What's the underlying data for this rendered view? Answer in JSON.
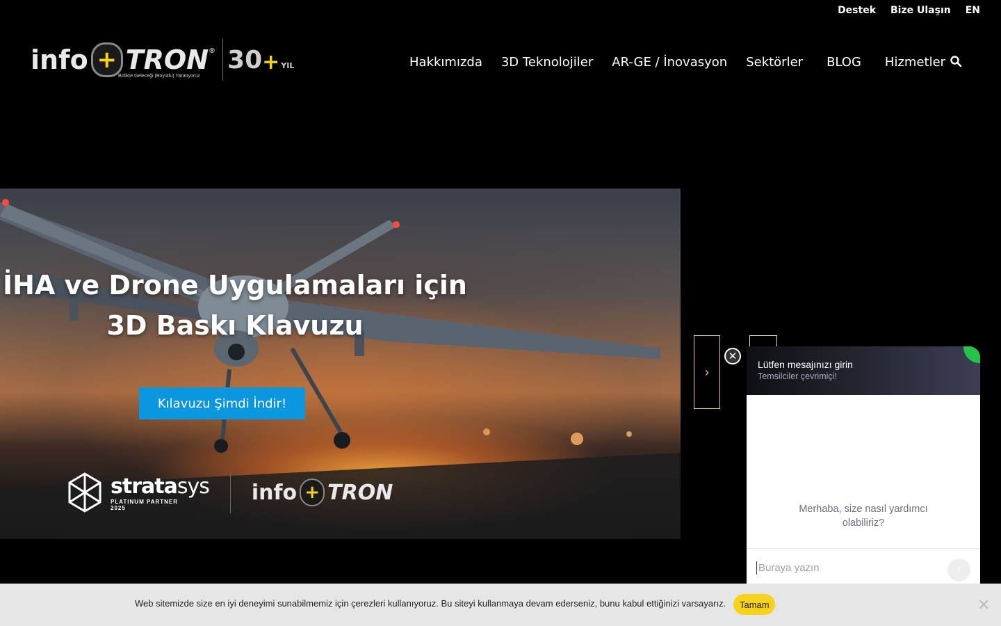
{
  "topbar": {
    "support": "Destek",
    "contact": "Bize Ulaşın",
    "lang": "EN"
  },
  "logo": {
    "info": "info",
    "plus": "+",
    "tron": "TRON",
    "reg": "®",
    "tagline": "Birlikte Geleceği (Boyutlu) Yaratıyoruz",
    "anniv_num": "30",
    "anniv_plus": "+",
    "anniv_label": "YIL"
  },
  "nav": {
    "items": [
      "Hakkımızda",
      "3D Teknolojiler",
      "AR-GE / İnovasyon",
      "Sektörler",
      "BLOG",
      "Hizmetler"
    ]
  },
  "hero": {
    "title_line1": "İHA ve Drone Uygulamaları için",
    "title_line2": "3D Baskı Klavuzu",
    "cta": "Kılavuzu Şimdi İndir!",
    "partner": {
      "brand_bold": "strata",
      "brand_light": "sys",
      "badge_line1": "PLATINUM PARTNER",
      "badge_line2": "2025"
    }
  },
  "chat": {
    "header_title": "Lütfen mesajınızı girin",
    "header_sub": "Temsilciler çevrimiçi!",
    "greeting": "Merhaba, size nasıl yardımcı olabiliriz?",
    "placeholder": "Buraya yazın"
  },
  "cookie": {
    "text": "Web sitemizde size en iyi deneyimi sunabilmemiz için çerezleri kullanıyoruz. Bu siteyi kullanmaya devam ederseniz, bunu kabul ettiğinizi varsayarız.",
    "accept": "Tamam"
  },
  "colors": {
    "accent_yellow": "#f6d21a",
    "cta_blue": "#0b97e0",
    "online_green": "#27c24a"
  }
}
